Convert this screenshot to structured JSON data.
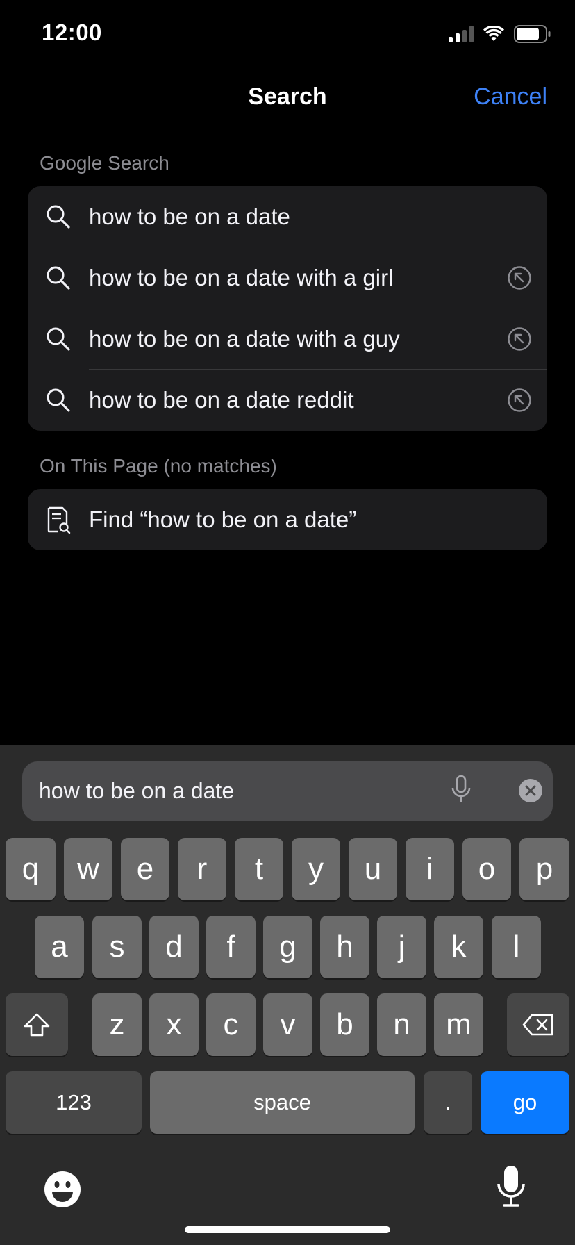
{
  "status_bar": {
    "time": "12:00"
  },
  "header": {
    "title": "Search",
    "cancel_label": "Cancel"
  },
  "google_section": {
    "label": "Google Search",
    "suggestions": [
      {
        "text": "how to be on a date",
        "has_fill": false
      },
      {
        "text": "how to be on a date with a girl",
        "has_fill": true
      },
      {
        "text": "how to be on a date with a guy",
        "has_fill": true
      },
      {
        "text": "how to be on a date reddit",
        "has_fill": true
      }
    ]
  },
  "page_section": {
    "label": "On This Page (no matches)",
    "find_text": "Find “how to be on a date”"
  },
  "search_field": {
    "value": "how to be on a date"
  },
  "keyboard": {
    "row1": [
      "q",
      "w",
      "e",
      "r",
      "t",
      "y",
      "u",
      "i",
      "o",
      "p"
    ],
    "row2": [
      "a",
      "s",
      "d",
      "f",
      "g",
      "h",
      "j",
      "k",
      "l"
    ],
    "row3": [
      "z",
      "x",
      "c",
      "v",
      "b",
      "n",
      "m"
    ],
    "numbers_label": "123",
    "space_label": "space",
    "period_label": ".",
    "go_label": "go"
  },
  "colors": {
    "accent": "#3e82f7",
    "go_key": "#0a7aff"
  }
}
